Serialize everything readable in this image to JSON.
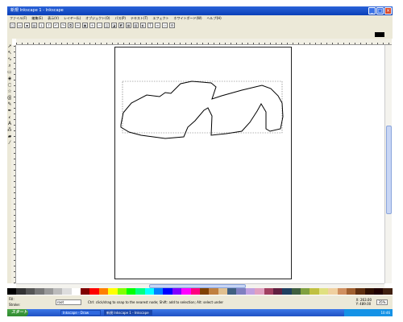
{
  "window": {
    "title": "新規 Inkscape 1 - Inkscape",
    "minimize": "_",
    "maximize": "□",
    "close": "×"
  },
  "menu": [
    "ファイル(F)",
    "編集(E)",
    "表示(V)",
    "レイヤー(L)",
    "オブジェクト(O)",
    "パス(P)",
    "テキスト(T)",
    "エフェクト",
    "ホワイトボード(W)",
    "ヘルプ(H)"
  ],
  "status": {
    "fill_label": "Fill:",
    "stroke_label": "Stroke:",
    "layer": "root",
    "message": "Ctrl: click/drag to snap to the nearest node; Shift: add to selection; Alt: select under",
    "x": "X: 263.00",
    "y": "Y: 489.00",
    "zoom": "35%"
  },
  "taskbar": {
    "start": "スタート",
    "tasks": [
      "Inkscape - Draw",
      "新規 Inkscape 1 - Inkscape"
    ],
    "clock": "10:46"
  },
  "colors": {
    "titlebar": "#0a3fb8",
    "chrome": "#ece9d8",
    "taskbar": "#1f52c4",
    "palette": [
      "#000000",
      "#333333",
      "#555555",
      "#777777",
      "#999999",
      "#bbbbbb",
      "#dddddd",
      "#ffffff",
      "#800000",
      "#ff0000",
      "#ff8000",
      "#ffff00",
      "#80ff00",
      "#00ff00",
      "#00ff80",
      "#00ffff",
      "#0080ff",
      "#0000ff",
      "#8000ff",
      "#ff00ff",
      "#ff0080",
      "#804000",
      "#c08040",
      "#e0c090",
      "#406080",
      "#8080c0",
      "#c0a0e0",
      "#e0a0c0",
      "#a04060",
      "#602040",
      "#204060",
      "#406040",
      "#80a040",
      "#c0c040",
      "#e0e080",
      "#f0d0a0",
      "#d09060",
      "#a06030",
      "#603010",
      "#301000",
      "#200000",
      "#402010"
    ]
  }
}
